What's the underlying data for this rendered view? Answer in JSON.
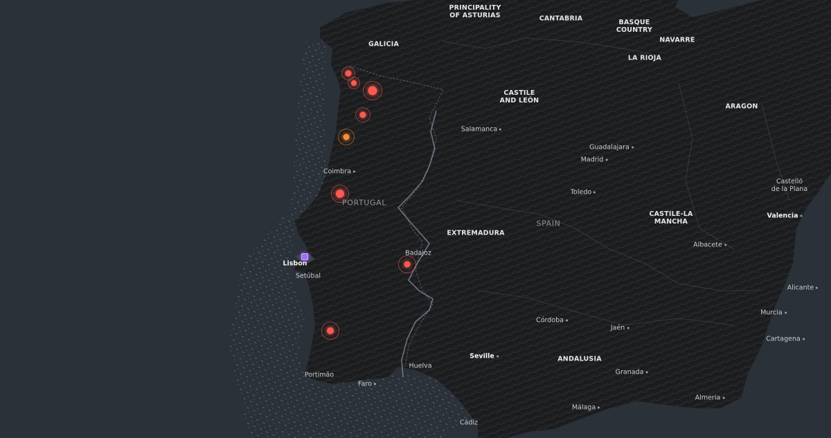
{
  "map": {
    "colors": {
      "sea": "#2b3138",
      "land": "#1c1d1f",
      "river": "#7a8596",
      "border": "#55575b",
      "marker_red": "#ff5a52",
      "marker_orange": "#ff8c2a",
      "marker_purple": "#a06bff"
    },
    "country_labels": {
      "portugal": "PORTUGAL",
      "spain": "SPAIN"
    },
    "region_labels": {
      "asturias": "PRINCIPALITY\nOF ASTURIAS",
      "cantabria": "CANTABRIA",
      "basque": "BASQUE\nCOUNTRY",
      "navarre": "NAVARRE",
      "galicia": "GALICIA",
      "la_rioja": "LA RIOJA",
      "castile_leon": "CASTILE\nAND LEÓN",
      "aragon": "ARAGON",
      "extremadura": "EXTREMADURA",
      "castile_la_mancha": "CASTILE-LA\nMANCHA",
      "andalusia": "ANDALUSIA"
    },
    "city_labels": {
      "salamanca": "Salamanca",
      "guadalajara": "Guadalajara",
      "madrid": "Madrid",
      "coimbra": "Coimbra",
      "castello": "Castelló\nde la Plana",
      "toledo": "Toledo",
      "valencia": "Valencia",
      "albacete": "Albacete",
      "badajoz": "Badajoz",
      "lisbon": "Lisbon",
      "setubal": "Setúbal",
      "alicante": "Alicante",
      "murcia": "Murcia",
      "cordoba": "Córdoba",
      "jaen": "Jaén",
      "cartagena": "Cartagena",
      "sevilla": "Seville",
      "huelva": "Huelva",
      "granada": "Granada",
      "portimao": "Portimão",
      "faro": "Faro",
      "almeria": "Almeria",
      "malaga": "Málaga",
      "cadiz": "Cádiz"
    },
    "markers": [
      {
        "id": "galicia-1",
        "color": "red"
      },
      {
        "id": "galicia-2",
        "color": "red"
      },
      {
        "id": "galicia-3",
        "color": "red"
      },
      {
        "id": "galicia-4",
        "color": "red"
      },
      {
        "id": "porto",
        "color": "orange"
      },
      {
        "id": "coimbra-area",
        "color": "red"
      },
      {
        "id": "badajoz-area",
        "color": "red"
      },
      {
        "id": "algarve",
        "color": "red"
      },
      {
        "id": "lisbon",
        "color": "purple"
      }
    ]
  }
}
